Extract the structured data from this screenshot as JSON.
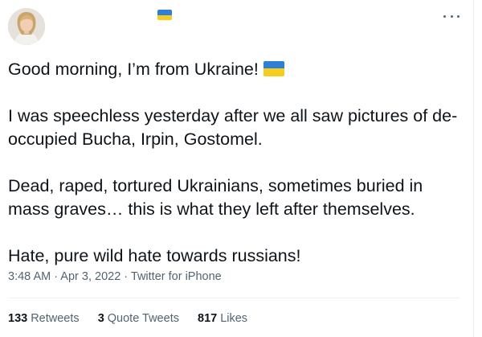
{
  "tweet": {
    "intro_text": "Good morning, I’m from Ukraine!",
    "paragraphs": [
      "I was speechless yesterday after we all saw pictures of de-occupied Bucha, Irpin, Gostomel.",
      "Dead, raped, tortured Ukrainians, sometimes buried in mass graves… this is what they left after themselves.",
      "Hate, pure wild hate towards russians!"
    ],
    "flag_icon": "ukraine-flag-emoji"
  },
  "header": {
    "flag_icon": "ukraine-flag-emoji",
    "more_icon": "more-options-icon"
  },
  "meta": {
    "time": "3:48 AM",
    "separator": " · ",
    "date": "Apr 3, 2022",
    "source": "Twitter for iPhone"
  },
  "stats": {
    "retweets_count": "133",
    "retweets_label": "Retweets",
    "quotes_count": "3",
    "quotes_label": "Quote Tweets",
    "likes_count": "817",
    "likes_label": "Likes"
  },
  "colors": {
    "text": "#0f1419",
    "secondary": "#536471",
    "flag_blue": "#2f7fd6",
    "flag_yellow": "#f5cd1e"
  }
}
